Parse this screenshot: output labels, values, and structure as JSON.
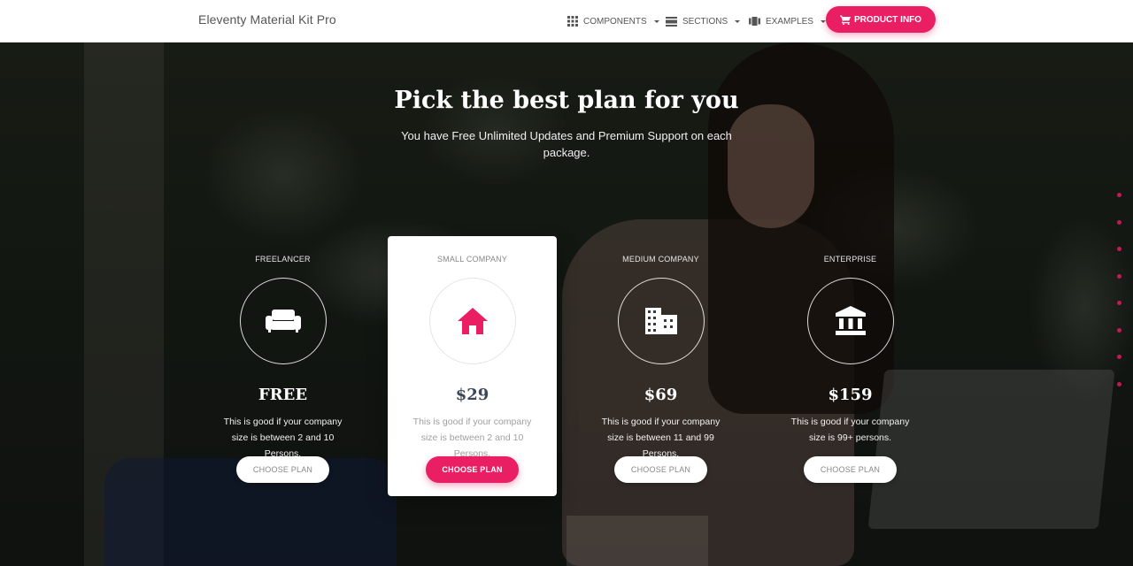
{
  "navbar": {
    "brand": "Eleventy Material Kit Pro",
    "items": [
      {
        "label": "Components",
        "icon": "apps-grid-icon"
      },
      {
        "label": "Sections",
        "icon": "view-day-icon"
      },
      {
        "label": "Examples",
        "icon": "view-carousel-icon"
      }
    ],
    "cta_label": "Product Info",
    "cta_icon": "shopping-cart-icon"
  },
  "hero": {
    "title": "Pick the best plan for you",
    "subtitle": "You have Free Unlimited Updates and Premium Support on each package."
  },
  "plans": [
    {
      "category": "Freelancer",
      "icon": "couch-icon",
      "price": "FREE",
      "description": "This is good if your company size is between 2 and 10 Persons.",
      "button": "Choose Plan",
      "featured": false
    },
    {
      "category": "Small Company",
      "icon": "home-icon",
      "price": "$29",
      "description": "This is good if your company size is between 2 and 10 Persons.",
      "button": "Choose Plan",
      "featured": true
    },
    {
      "category": "Medium Company",
      "icon": "business-icon",
      "price": "$69",
      "description": "This is good if your company size is between 11 and 99 Persons.",
      "button": "Choose Plan",
      "featured": false
    },
    {
      "category": "Enterprise",
      "icon": "bank-icon",
      "price": "$159",
      "description": "This is good if your company size is 99+ persons.",
      "button": "Choose Plan",
      "featured": false
    }
  ],
  "colors": {
    "accent": "#e91e63",
    "navbar_bg": "#ffffff",
    "title_dark": "#3c4858"
  },
  "dot_navigation_count": 8
}
